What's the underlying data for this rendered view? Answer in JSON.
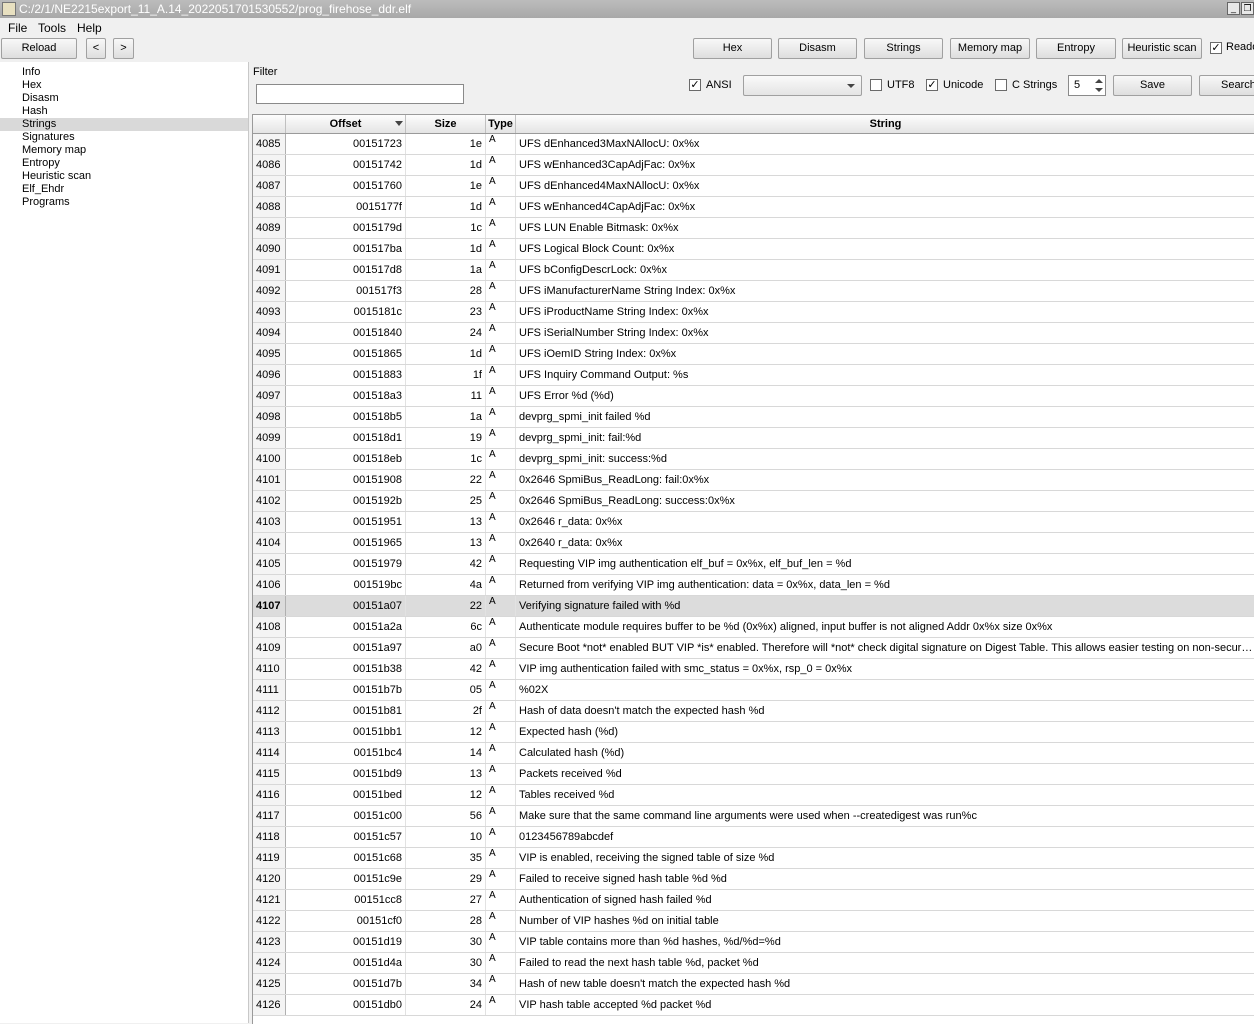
{
  "window": {
    "title": "C:/2/1/NE2215export_11_A.14_2022051701530552/prog_firehose_ddr.elf"
  },
  "menu": [
    "File",
    "Tools",
    "Help"
  ],
  "toolbar": {
    "reload": "Reload",
    "back": "<",
    "forward": ">",
    "views": [
      "Hex",
      "Disasm",
      "Strings",
      "Memory map",
      "Entropy",
      "Heuristic scan"
    ],
    "readonly_label": "Reado",
    "readonly_checked": true
  },
  "nav": {
    "items": [
      "Info",
      "Hex",
      "Disasm",
      "Hash",
      "Strings",
      "Signatures",
      "Memory map",
      "Entropy",
      "Heuristic scan",
      "Elf_Ehdr",
      "Programs"
    ],
    "selected": "Strings"
  },
  "filter": {
    "label": "Filter",
    "value": "",
    "ansi_label": "ANSI",
    "ansi_checked": true,
    "encoding_value": "",
    "utf8_label": "UTF8",
    "utf8_checked": false,
    "unicode_label": "Unicode",
    "unicode_checked": true,
    "cstrings_label": "C Strings",
    "cstrings_checked": false,
    "min_length": "5",
    "save": "Save",
    "search": "Search"
  },
  "table": {
    "columns": {
      "offset": "Offset",
      "size": "Size",
      "type": "Type",
      "string": "String"
    },
    "selected_row": "4107",
    "rows": [
      [
        "4085",
        "00151723",
        "1e",
        "A",
        "UFS dEnhanced3MaxNAllocU: 0x%x"
      ],
      [
        "4086",
        "00151742",
        "1d",
        "A",
        "UFS wEnhanced3CapAdjFac: 0x%x"
      ],
      [
        "4087",
        "00151760",
        "1e",
        "A",
        "UFS dEnhanced4MaxNAllocU: 0x%x"
      ],
      [
        "4088",
        "0015177f",
        "1d",
        "A",
        "UFS wEnhanced4CapAdjFac: 0x%x"
      ],
      [
        "4089",
        "0015179d",
        "1c",
        "A",
        "UFS LUN Enable Bitmask: 0x%x"
      ],
      [
        "4090",
        "001517ba",
        "1d",
        "A",
        "UFS Logical Block Count: 0x%x"
      ],
      [
        "4091",
        "001517d8",
        "1a",
        "A",
        "UFS bConfigDescrLock: 0x%x"
      ],
      [
        "4092",
        "001517f3",
        "28",
        "A",
        "UFS iManufacturerName String Index: 0x%x"
      ],
      [
        "4093",
        "0015181c",
        "23",
        "A",
        "UFS iProductName String Index: 0x%x"
      ],
      [
        "4094",
        "00151840",
        "24",
        "A",
        "UFS iSerialNumber String Index: 0x%x"
      ],
      [
        "4095",
        "00151865",
        "1d",
        "A",
        "UFS iOemID String Index: 0x%x"
      ],
      [
        "4096",
        "00151883",
        "1f",
        "A",
        "UFS Inquiry Command Output: %s"
      ],
      [
        "4097",
        "001518a3",
        "11",
        "A",
        "UFS Error %d (%d)"
      ],
      [
        "4098",
        "001518b5",
        "1a",
        "A",
        "devprg_spmi_init failed %d"
      ],
      [
        "4099",
        "001518d1",
        "19",
        "A",
        "devprg_spmi_init: fail:%d"
      ],
      [
        "4100",
        "001518eb",
        "1c",
        "A",
        "devprg_spmi_init: success:%d"
      ],
      [
        "4101",
        "00151908",
        "22",
        "A",
        "0x2646 SpmiBus_ReadLong: fail:0x%x"
      ],
      [
        "4102",
        "0015192b",
        "25",
        "A",
        "0x2646 SpmiBus_ReadLong: success:0x%x"
      ],
      [
        "4103",
        "00151951",
        "13",
        "A",
        "0x2646 r_data: 0x%x"
      ],
      [
        "4104",
        "00151965",
        "13",
        "A",
        "0x2640 r_data: 0x%x"
      ],
      [
        "4105",
        "00151979",
        "42",
        "A",
        "Requesting VIP img authentication elf_buf = 0x%x, elf_buf_len = %d"
      ],
      [
        "4106",
        "001519bc",
        "4a",
        "A",
        "Returned from verifying VIP img authentication: data = 0x%x, data_len = %d"
      ],
      [
        "4107",
        "00151a07",
        "22",
        "A",
        "Verifying signature failed with %d"
      ],
      [
        "4108",
        "00151a2a",
        "6c",
        "A",
        "Authenticate module requires buffer to be %d (0x%x) aligned, input buffer is not aligned Addr 0x%x size 0x%x"
      ],
      [
        "4109",
        "00151a97",
        "a0",
        "A",
        "Secure Boot *not* enabled BUT VIP *is* enabled. Therefore will *not* check digital signature on Digest Table. This allows easier testing on non-secure ..."
      ],
      [
        "4110",
        "00151b38",
        "42",
        "A",
        "VIP img authentication failed with smc_status = 0x%x, rsp_0 = 0x%x"
      ],
      [
        "4111",
        "00151b7b",
        "05",
        "A",
        "%02X"
      ],
      [
        "4112",
        "00151b81",
        "2f",
        "A",
        "Hash of data doesn't match the expected hash %d"
      ],
      [
        "4113",
        "00151bb1",
        "12",
        "A",
        "Expected hash (%d)"
      ],
      [
        "4114",
        "00151bc4",
        "14",
        "A",
        "Calculated hash (%d)"
      ],
      [
        "4115",
        "00151bd9",
        "13",
        "A",
        "Packets received %d"
      ],
      [
        "4116",
        "00151bed",
        "12",
        "A",
        "Tables received %d"
      ],
      [
        "4117",
        "00151c00",
        "56",
        "A",
        "Make sure that the same command line arguments were used when --createdigest was run%c"
      ],
      [
        "4118",
        "00151c57",
        "10",
        "A",
        "0123456789abcdef"
      ],
      [
        "4119",
        "00151c68",
        "35",
        "A",
        "VIP is enabled, receiving the signed table of size %d"
      ],
      [
        "4120",
        "00151c9e",
        "29",
        "A",
        "Failed to receive signed hash table %d %d"
      ],
      [
        "4121",
        "00151cc8",
        "27",
        "A",
        "Authentication of signed hash failed %d"
      ],
      [
        "4122",
        "00151cf0",
        "28",
        "A",
        "Number of VIP hashes %d on initial table"
      ],
      [
        "4123",
        "00151d19",
        "30",
        "A",
        "VIP table contains more than %d hashes, %d/%d=%d"
      ],
      [
        "4124",
        "00151d4a",
        "30",
        "A",
        "Failed to read the next hash table %d, packet %d"
      ],
      [
        "4125",
        "00151d7b",
        "34",
        "A",
        "Hash of new table doesn't match the expected hash %d"
      ],
      [
        "4126",
        "00151db0",
        "24",
        "A",
        "VIP hash table accepted %d packet %d"
      ]
    ]
  }
}
